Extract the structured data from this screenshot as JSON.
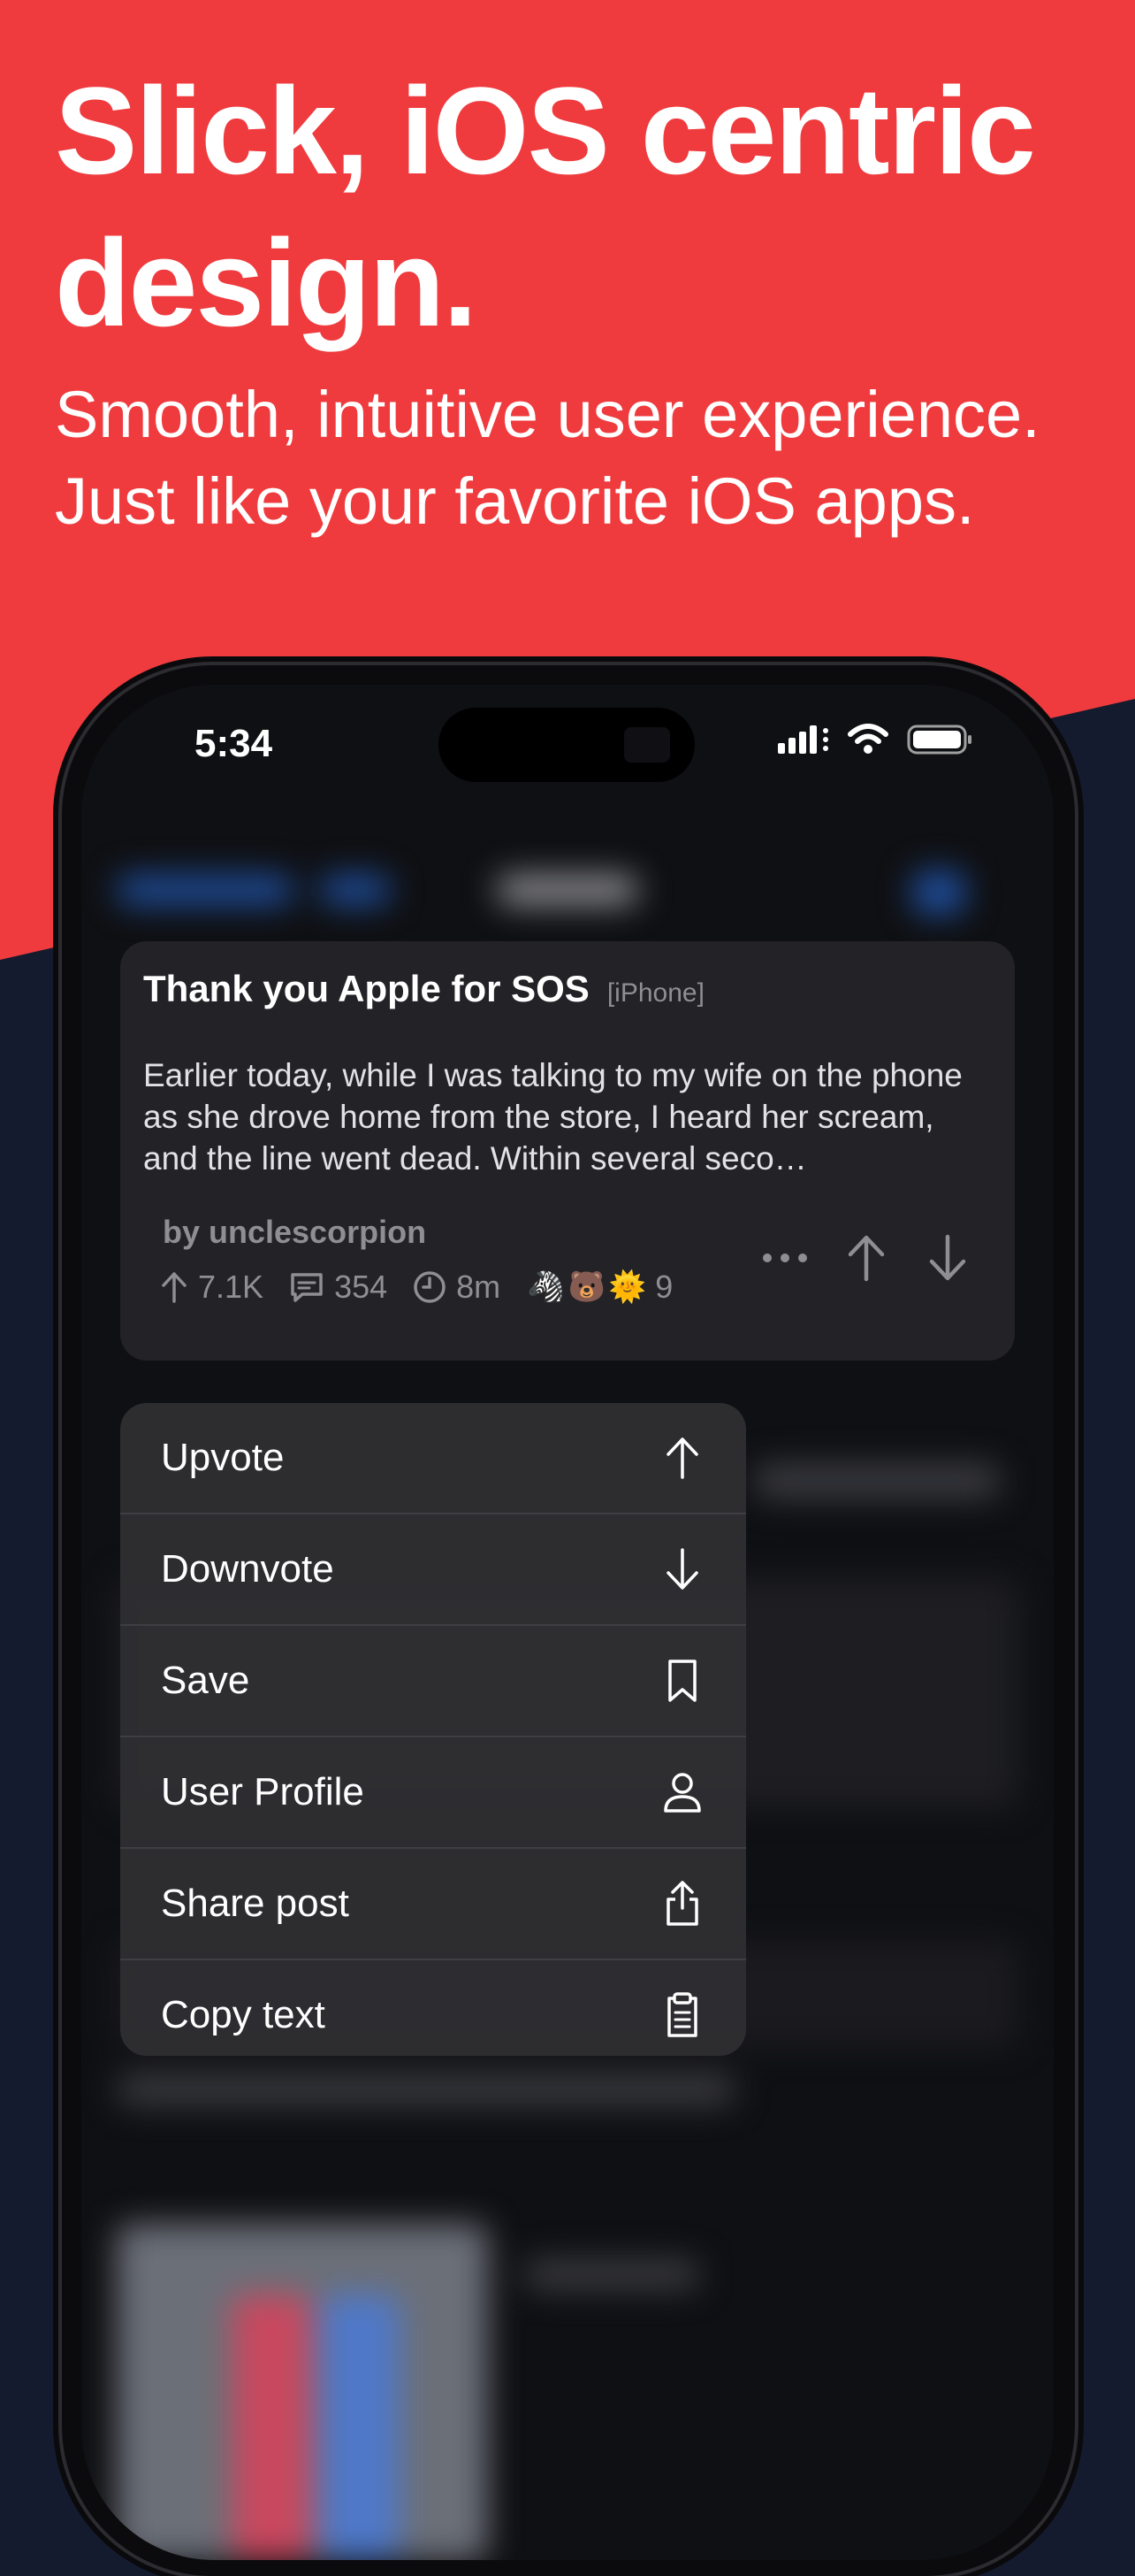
{
  "promo": {
    "headline": "Slick, iOS centric design.",
    "subline_line1": "Smooth, intuitive user experience.",
    "subline_line2": "Just like your favorite iOS apps."
  },
  "colors": {
    "brand_red": "#ef3b3e",
    "navy_bg": "#151b2e",
    "card_bg": "#232327",
    "menu_bg": "#2e2e32"
  },
  "status_bar": {
    "time": "5:34",
    "icons": [
      "signal-icon",
      "wifi-icon",
      "battery-icon"
    ]
  },
  "post": {
    "title": "Thank you Apple for SOS",
    "flair": "[iPhone]",
    "body": "Earlier today, while I was talking to my wife on the phone as she drove home from the store, I heard her scream, and the line went dead. Within several seco…",
    "author": "by unclescorpion",
    "upvotes": "7.1K",
    "comments": "354",
    "age": "8m",
    "awards": [
      "🦓",
      "🐻",
      "🌞"
    ],
    "award_count": "9"
  },
  "context_menu": {
    "items": [
      {
        "label": "Upvote",
        "icon": "arrow-up-icon"
      },
      {
        "label": "Downvote",
        "icon": "arrow-down-icon"
      },
      {
        "label": "Save",
        "icon": "bookmark-icon"
      },
      {
        "label": "User Profile",
        "icon": "person-icon"
      },
      {
        "label": "Share post",
        "icon": "share-icon"
      },
      {
        "label": "Copy text",
        "icon": "clipboard-icon"
      }
    ]
  }
}
